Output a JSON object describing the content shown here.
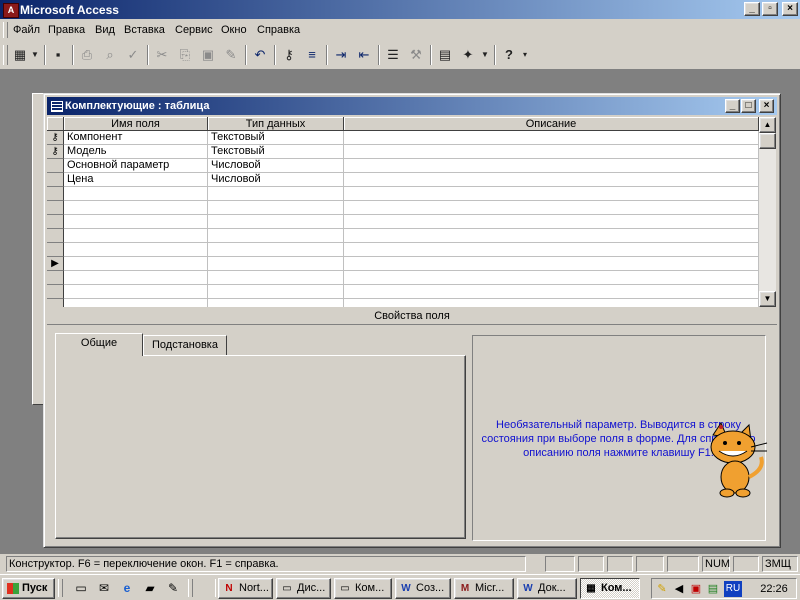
{
  "app": {
    "title": "Microsoft Access",
    "min_label": "_",
    "max_label": "▫",
    "close_label": "×"
  },
  "menu": [
    "Файл",
    "Правка",
    "Вид",
    "Вставка",
    "Сервис",
    "Окно",
    "Справка"
  ],
  "toolbar": {
    "buttons": [
      {
        "name": "design-view-icon",
        "glyph": "▦"
      },
      {
        "name": "save-icon",
        "glyph": "▪"
      },
      {
        "name": "print-icon",
        "glyph": "⎙"
      },
      {
        "name": "print-preview-icon",
        "glyph": "⌕"
      },
      {
        "name": "spelling-icon",
        "glyph": "✓"
      },
      {
        "name": "cut-icon",
        "glyph": "✂"
      },
      {
        "name": "copy-icon",
        "glyph": "⎘"
      },
      {
        "name": "paste-icon",
        "glyph": "▣"
      },
      {
        "name": "format-painter-icon",
        "glyph": "✎"
      },
      {
        "name": "undo-icon",
        "glyph": "↶"
      },
      {
        "name": "primary-key-icon",
        "glyph": "⚷"
      },
      {
        "name": "indexes-icon",
        "glyph": "≡"
      },
      {
        "name": "insert-rows-icon",
        "glyph": "⇥"
      },
      {
        "name": "delete-rows-icon",
        "glyph": "⇤"
      },
      {
        "name": "properties-icon",
        "glyph": "☰"
      },
      {
        "name": "build-icon",
        "glyph": "⚒"
      },
      {
        "name": "database-window-icon",
        "glyph": "▤"
      },
      {
        "name": "new-object-icon",
        "glyph": "✦"
      },
      {
        "name": "help-icon",
        "glyph": "?"
      }
    ]
  },
  "table_window": {
    "title": "Комплектующие : таблица",
    "columns": [
      "Имя поля",
      "Тип данных",
      "Описание"
    ],
    "rows": [
      {
        "key": true,
        "name": "Компонент",
        "type": "Текстовый",
        "desc": ""
      },
      {
        "key": true,
        "name": "Модель",
        "type": "Текстовый",
        "desc": ""
      },
      {
        "key": false,
        "name": "Основной параметр",
        "type": "Числовой",
        "desc": ""
      },
      {
        "key": false,
        "name": "Цена",
        "type": "Числовой",
        "desc": ""
      }
    ],
    "current_row_marker": "▶",
    "field_props_label": "Свойства поля",
    "tabs": [
      "Общие",
      "Подстановка"
    ],
    "help_text": "Необязательный параметр. Выводится в строку состояния при выборе поля в форме. Для справки по описанию поля нажмите клавишу F1."
  },
  "status": {
    "text": "Конструктор.  F6 = переключение окон.  F1 = справка.",
    "num": "NUM",
    "lang": "ЗМЩ"
  },
  "taskbar": {
    "start": "Пуск",
    "tasks": [
      {
        "label": "Nort...",
        "icon": "N"
      },
      {
        "label": "Дис...",
        "icon": "▭"
      },
      {
        "label": "Ком...",
        "icon": "▭"
      },
      {
        "label": "Соз...",
        "icon": "W"
      },
      {
        "label": "Micr...",
        "icon": "M"
      },
      {
        "label": "Док...",
        "icon": "W"
      },
      {
        "label": "Ком...",
        "icon": "▦"
      }
    ],
    "tray_lang": "RU",
    "clock": "22:26"
  }
}
